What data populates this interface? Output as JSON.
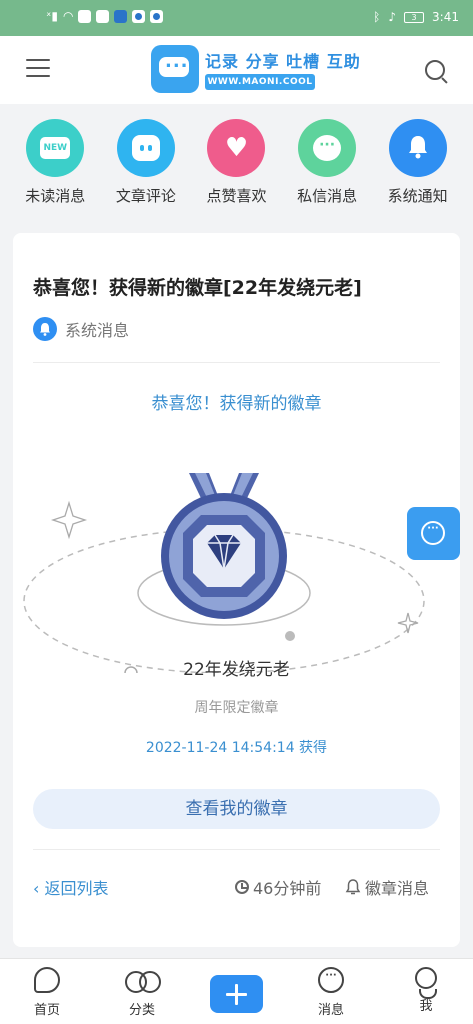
{
  "status_bar": {
    "time": "3:41",
    "battery": "3"
  },
  "header": {
    "logo_text": "记录 分享 吐槽 互助",
    "logo_url": "WWW.MAONI.COOL",
    "menu_icon": "menu-icon",
    "search_icon": "search-icon"
  },
  "categories": [
    {
      "label": "未读消息",
      "icon": "new-icon",
      "icon_text": "NEW",
      "color": "#3ccfc9"
    },
    {
      "label": "文章评论",
      "icon": "comment-face-icon",
      "color": "#2fb4f0"
    },
    {
      "label": "点赞喜欢",
      "icon": "heart-icon",
      "color": "#ef5c8c"
    },
    {
      "label": "私信消息",
      "icon": "chat-icon",
      "icon_text": "···",
      "color": "#5ed39c"
    },
    {
      "label": "系统通知",
      "icon": "bell-icon",
      "color": "#2f8ff2"
    }
  ],
  "card": {
    "title": "恭喜您！获得新的徽章[22年发绕元老]",
    "source": "系统消息",
    "congrats": "恭喜您！获得新的徽章",
    "badge_name": "22年发绕元老",
    "badge_subtitle": "周年限定徽章",
    "obtained_time": "2022-11-24 14:54:14 获得",
    "view_button": "查看我的徽章",
    "back_link": "‹ 返回列表",
    "time_ago": "46分钟前",
    "message_type": "徽章消息"
  },
  "bottom_nav": [
    {
      "label": "首页",
      "icon": "home-icon"
    },
    {
      "label": "分类",
      "icon": "category-icon"
    },
    {
      "label": "",
      "icon": "plus-icon"
    },
    {
      "label": "消息",
      "icon": "message-icon"
    },
    {
      "label": "我",
      "icon": "profile-icon"
    }
  ],
  "colors": {
    "accent": "#2f8ff2",
    "link": "#3a8fd0",
    "status_bar": "#76b98c",
    "badge_dark": "#4257a0",
    "badge_light": "#8fa3d6"
  }
}
